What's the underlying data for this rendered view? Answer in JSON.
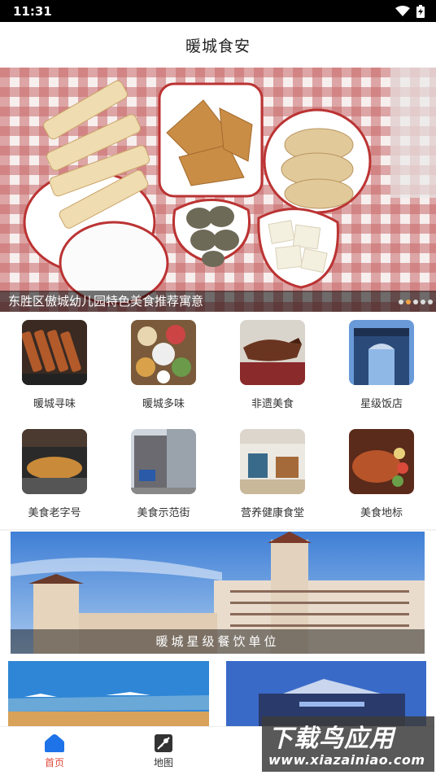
{
  "status_bar": {
    "time": "11:31",
    "icons": [
      "wifi-icon",
      "battery-charging-icon"
    ]
  },
  "header": {
    "title": "暖城食安"
  },
  "banner": {
    "caption": "东胜区傲城幼儿园特色美食推荐寓意",
    "dot_count": 5,
    "active_dot": 2
  },
  "categories": [
    {
      "label": "暖城寻味"
    },
    {
      "label": "暖城多味"
    },
    {
      "label": "非遗美食"
    },
    {
      "label": "星级饭店"
    },
    {
      "label": "美食老字号"
    },
    {
      "label": "美食示范街"
    },
    {
      "label": "营养健康食堂"
    },
    {
      "label": "美食地标"
    }
  ],
  "feature_banner": {
    "caption": "暖城星级餐饮单位"
  },
  "tabbar": {
    "items": [
      {
        "label": "首页",
        "icon": "home-icon",
        "active": true
      },
      {
        "label": "地图",
        "icon": "map-icon",
        "active": false
      }
    ]
  },
  "watermark": {
    "line1": "下载鸟应用",
    "line2": "www.xiazainiao.com"
  },
  "colors": {
    "accent": "#e24a3b",
    "tab_active_icon": "#1e73e8",
    "dot_active": "#f4a340"
  }
}
